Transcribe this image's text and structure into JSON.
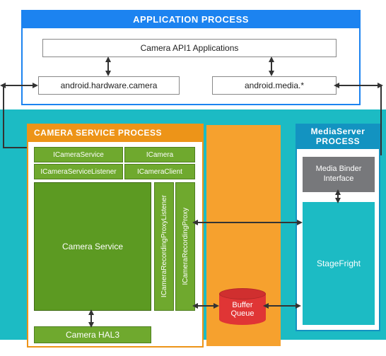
{
  "app_process": {
    "title": "APPLICATION PROCESS",
    "api_box": "Camera API1 Applications",
    "hw": "android.hardware.camera",
    "media": "android.media.*"
  },
  "camera_service_process": {
    "title": "CAMERA SERVICE PROCESS",
    "icamera_service": "ICameraService",
    "icamera": "ICamera",
    "icamera_service_listener": "ICameraServiceListener",
    "icamera_client": "ICameraClient",
    "recording_proxy_listener": "ICameraRecordingProxyListener",
    "recording_proxy": "ICameraRecordingProxy",
    "camera_service": "Camera Service",
    "camera_hal": "Camera HAL3"
  },
  "mediaserver_process": {
    "title": "MediaServer PROCESS",
    "binder": "Media Binder Interface",
    "stagefright": "StageFright"
  },
  "buffer_queue": {
    "label_l1": "Buffer",
    "label_l2": "Queue"
  },
  "annot_sendcmd": ""
}
